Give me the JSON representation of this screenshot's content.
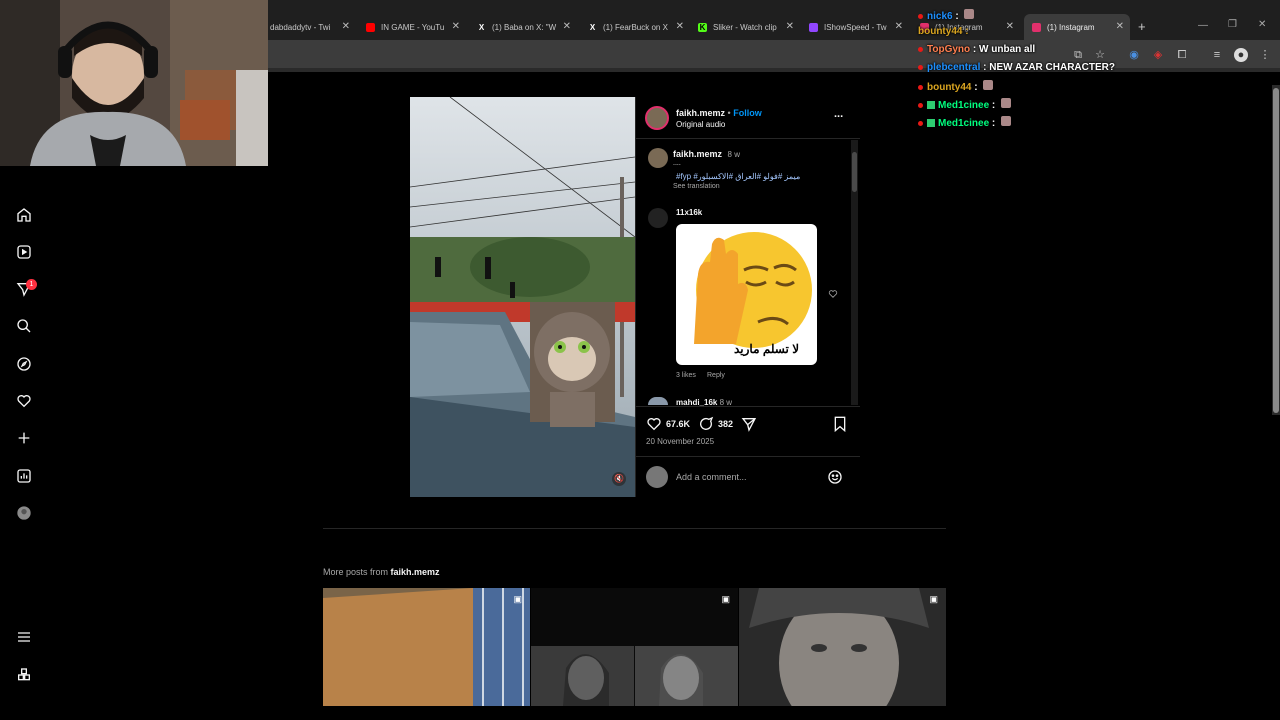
{
  "browser": {
    "tabs": [
      {
        "label": "dabdaddytv - Twi",
        "icon": "twitch-icon",
        "color": "#9146ff"
      },
      {
        "label": "IN GAME - YouTu",
        "icon": "youtube-icon",
        "color": "#ff0000"
      },
      {
        "label": "(1) Baba on X: \"W",
        "icon": "x-icon",
        "color": "#ffffff"
      },
      {
        "label": "(1) FearBuck on X",
        "icon": "x-icon",
        "color": "#ffffff"
      },
      {
        "label": "Sliker - Watch clip",
        "icon": "kick-icon",
        "color": "#53fc18"
      },
      {
        "label": "IShowSpeed - Tw",
        "icon": "twitch-icon",
        "color": "#9146ff"
      },
      {
        "label": "(1) Instagram",
        "icon": "instagram-icon",
        "color": "#e1306c"
      },
      {
        "label": "(1) Instagram",
        "icon": "instagram-icon",
        "color": "#e1306c"
      }
    ],
    "new_tab": "+"
  },
  "post": {
    "author": "faikh.memz",
    "follow": "Follow",
    "separator": "•",
    "audio": "Original audio",
    "more": "...",
    "caption": {
      "author": "faikh.memz",
      "age": "8 w",
      "dots": "....",
      "hashtags": "#fyp #ميمز #فولو #العراق #الاكسبلور",
      "see_translation": "See translation"
    },
    "comments": [
      {
        "author": "11x16k",
        "sticker_text": "لا تسلم ماريد",
        "likes": "3 likes",
        "reply": "Reply"
      },
      {
        "author": "mahdi_16k",
        "age": "8 w"
      }
    ],
    "likes": "67.6K",
    "comments_count": "382",
    "date": "20 November 2025",
    "add_comment_placeholder": "Add a comment..."
  },
  "more_posts": {
    "prefix": "More posts from ",
    "author": "faikh.memz"
  },
  "chat": [
    {
      "user": "nick6",
      "color": "#1e90ff",
      "msg": ""
    },
    {
      "user": "TopGyno",
      "color": "#ff7f50",
      "msg": "W unban all"
    },
    {
      "user": "plebcentral",
      "color": "#1e90ff",
      "msg": "NEW AZAR CHARACTER?"
    },
    {
      "user": "bounty44",
      "color": "#daa520",
      "msg": ""
    },
    {
      "user": "Med1cinee",
      "color": "#00ff7f",
      "msg": ""
    },
    {
      "user": "Med1cinee",
      "color": "#00ff7f",
      "msg": ""
    }
  ],
  "chat_overlap_user": "bounty44",
  "colors": {
    "accent": "#0095f6",
    "notification": "#ff3040"
  }
}
